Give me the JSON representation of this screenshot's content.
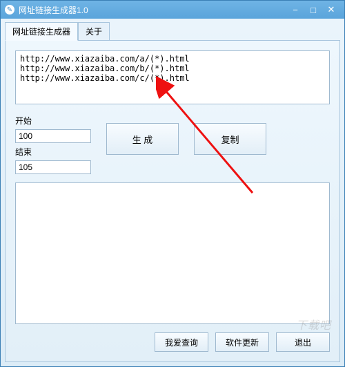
{
  "window": {
    "title": "网址链接生成器1.0"
  },
  "tabs": {
    "main": "网址链接生成器",
    "about": "关于"
  },
  "url_input": "http://www.xiazaiba.com/a/(*).html\nhttp://www.xiazaiba.com/b/(*).html\nhttp://www.xiazaiba.com/c/(*).html",
  "range": {
    "start_label": "开始",
    "start_value": "100",
    "end_label": "结束",
    "end_value": "105"
  },
  "buttons": {
    "generate": "生 成",
    "copy": "复制",
    "query": "我爱查询",
    "update": "软件更新",
    "exit": "退出"
  },
  "output": "",
  "watermark": "下载吧\nwww.xiazaiba.com"
}
